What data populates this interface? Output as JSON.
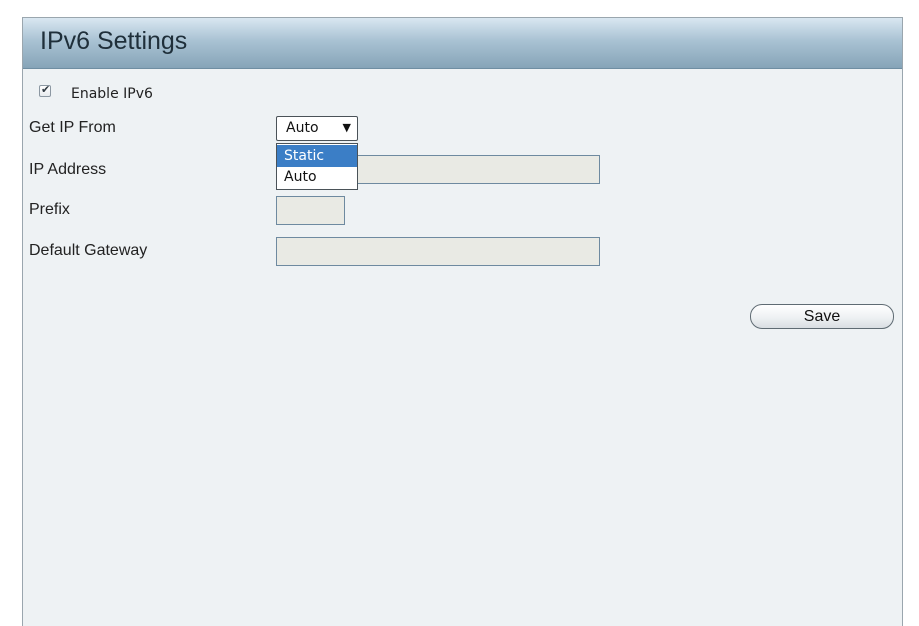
{
  "panel": {
    "title": "IPv6 Settings"
  },
  "enable_ipv6": {
    "label": "Enable IPv6",
    "checked": true
  },
  "get_ip_from": {
    "label": "Get IP From",
    "selected": "Auto",
    "options": [
      "Static",
      "Auto"
    ],
    "highlighted_option": "Static"
  },
  "ip_address": {
    "label": "IP Address",
    "value": ""
  },
  "prefix": {
    "label": "Prefix",
    "value": ""
  },
  "default_gateway": {
    "label": "Default Gateway",
    "value": ""
  },
  "actions": {
    "save_label": "Save"
  },
  "icons": {
    "checkbox_mark": "check-mark-icon",
    "select_arrow": "dropdown-arrow-icon"
  },
  "colors": {
    "header_gradient_top": "#d9e7f1",
    "header_gradient_bottom": "#86a4b8",
    "panel_background": "#eef2f4",
    "field_background": "#e9eae4",
    "selected_option": "#3b7ec6"
  }
}
